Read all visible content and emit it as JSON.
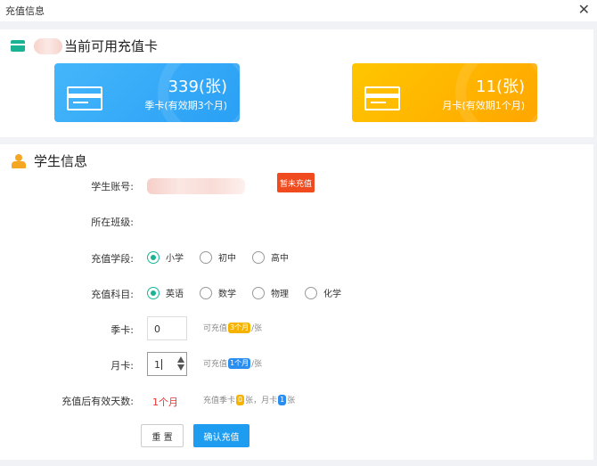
{
  "window": {
    "title": "充值信息",
    "close_icon": "close-icon"
  },
  "cards_section": {
    "title": "当前可用充值卡",
    "cards": [
      {
        "count": "339(张)",
        "desc": "季卡(有效期3个月)",
        "color": "#2aa0f5"
      },
      {
        "count": "11(张)",
        "desc": "月卡(有效期1个月)",
        "color": "#ffa600"
      }
    ]
  },
  "student_section": {
    "title": "学生信息",
    "account_label": "学生账号:",
    "account_status": "暂未充值",
    "class_label": "所在班级:",
    "stage_label": "充值学段:",
    "stage_options": [
      "小学",
      "初中",
      "高中"
    ],
    "stage_selected": "小学",
    "subject_label": "充值科目:",
    "subject_options": [
      "英语",
      "数学",
      "物理",
      "化学"
    ],
    "subject_selected": "英语",
    "season_label": "季卡:",
    "season_value": "0",
    "season_hint_pre": "可充值",
    "season_hint_pill": "3个月",
    "season_hint_post": "/张",
    "month_label": "月卡:",
    "month_value": "1",
    "month_hint_pre": "可充值",
    "month_hint_pill": "1个月",
    "month_hint_post": "/张",
    "days_label": "充值后有效天数:",
    "days_value": "1个月",
    "summary_pre": "充值季卡",
    "summary_season_count": "0",
    "summary_mid": "张，月卡",
    "summary_month_count": "1",
    "summary_post": "张",
    "reset_label": "重 置",
    "confirm_label": "确认充值",
    "accent_color": "#19b394",
    "status_color": "#f04b1e"
  }
}
